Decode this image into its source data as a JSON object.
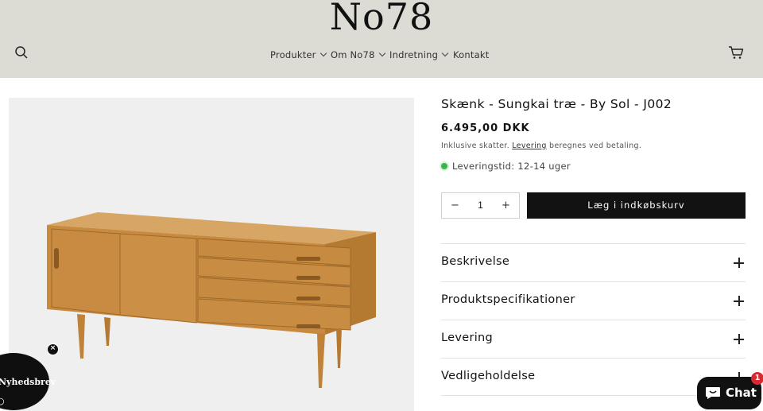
{
  "header": {
    "logo": "No78",
    "nav": [
      {
        "label": "Produkter",
        "has_dropdown": true
      },
      {
        "label": "Om No78",
        "has_dropdown": true
      },
      {
        "label": "Indretning",
        "has_dropdown": true
      },
      {
        "label": "Kontakt",
        "has_dropdown": false
      }
    ],
    "icons": {
      "search": "search-icon",
      "cart": "cart-icon"
    }
  },
  "product": {
    "title": "Skænk - Sungkai træ - By Sol - J002",
    "price": "6.495,00 DKK",
    "tax_note_prefix": "Inklusive skatter.",
    "tax_note_link": "Levering",
    "tax_note_suffix": "beregnes ved betaling.",
    "delivery_time": "Leveringstid: 12-14 uger",
    "quantity": "1",
    "minus": "−",
    "plus": "+",
    "add_to_cart": "Læg i indkøbskurv"
  },
  "accordion": [
    {
      "label": "Beskrivelse"
    },
    {
      "label": "Produktspecifikationer"
    },
    {
      "label": "Levering"
    },
    {
      "label": "Vedligeholdelse"
    }
  ],
  "widgets": {
    "newsletter_label": "Nyhedsbrev",
    "newsletter_close": "×",
    "chat_label": "Chat",
    "chat_badge": "1"
  },
  "colors": {
    "header_bg": "#dcdcd5",
    "button_bg": "#121212",
    "status_green": "#3bb54a",
    "badge_red": "#d8292f"
  }
}
